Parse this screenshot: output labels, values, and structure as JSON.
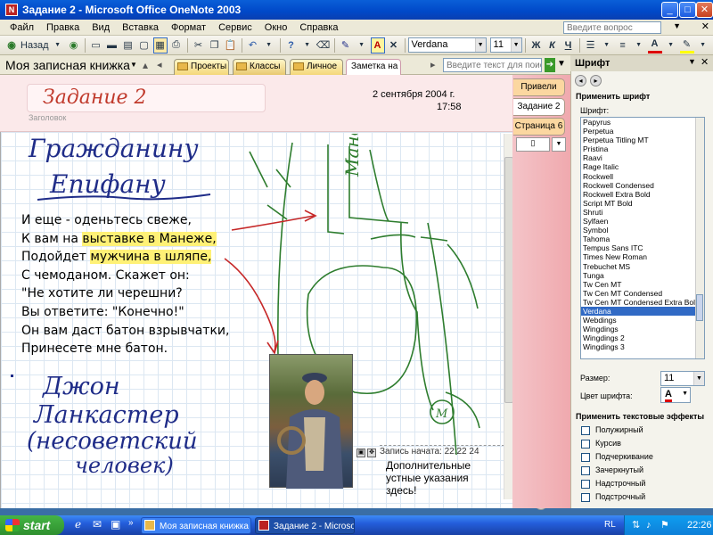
{
  "window": {
    "title": "Задание 2 - Microsoft Office OneNote 2003",
    "title_icon": "N"
  },
  "menu": [
    "Файл",
    "Правка",
    "Вид",
    "Вставка",
    "Формат",
    "Сервис",
    "Окно",
    "Справка"
  ],
  "help_placeholder": "Введите вопрос",
  "toolbar": {
    "back_label": "Назад",
    "font": "Verdana",
    "size": "11",
    "bold": "Ж",
    "italic": "К",
    "underline": "Ч"
  },
  "notebook": {
    "name": "Моя записная книжка"
  },
  "section_tabs": [
    "Проекты",
    "Классы",
    "Личное",
    "Заметка на п"
  ],
  "search_placeholder": "Введите текст для поиска",
  "page": {
    "title": "Задание 2",
    "title_label": "Заголовок",
    "date": "2 сентября 2004 г.",
    "time": "17:58",
    "hw_heading1": "Гражданину",
    "hw_heading2": "Епифану",
    "lines": [
      "И еще - оденьтесь свеже,",
      "К вам на выставке в Манеже,",
      "Подойдет мужчина в шляпе,",
      "С чемоданом. Скажет он:",
      "\"Не хотите ли черешни?",
      "Вы ответите: \"Конечно!\"",
      "Он вам даст батон взрывчатки,",
      "Принесете мне батон."
    ],
    "hl_1_pre": "К вам на ",
    "hl_1": "выставке в Манеже,",
    "hl_2_pre": "Подойдет ",
    "hl_2": "мужчина в шляпе,",
    "hw_sign": [
      "Джон",
      "Ланкастер",
      "(несоветский",
      "человек)"
    ],
    "map_label": "Манеже",
    "map_metro": "М"
  },
  "audio_note": {
    "header": "Запись начата: 22:22 24",
    "text": "Дополнительные устные указания здесь!"
  },
  "page_tabs": [
    "Привели",
    "Задание 2",
    "Страница 6"
  ],
  "task_pane": {
    "title": "Шрифт",
    "apply_font": "Применить шрифт",
    "font_label": "Шрифт:",
    "fonts": [
      "Papyrus",
      "Perpetua",
      "Perpetua Titling MT",
      "Pristina",
      "Raavi",
      "Rage Italic",
      "Rockwell",
      "Rockwell Condensed",
      "Rockwell Extra Bold",
      "Script MT Bold",
      "Shruti",
      "Sylfaen",
      "Symbol",
      "Tahoma",
      "Tempus Sans ITC",
      "Times New Roman",
      "Trebuchet MS",
      "Tunga",
      "Tw Cen MT",
      "Tw Cen MT Condensed",
      "Tw Cen MT Condensed Extra Bold",
      "Verdana",
      "Webdings",
      "Wingdings",
      "Wingdings 2",
      "Wingdings 3"
    ],
    "selected_font": "Verdana",
    "size_label": "Размер:",
    "size_value": "11",
    "color_label": "Цвет шрифта:",
    "effects_title": "Применить текстовые эффекты",
    "effects": [
      "Полужирный",
      "Курсив",
      "Подчеркивание",
      "Зачеркнутый",
      "Надстрочный",
      "Подстрочный"
    ]
  },
  "taskbar": {
    "start": "start",
    "items": [
      "Моя записная книжка",
      "Задание 2 - Microsof..."
    ],
    "lang": "RL",
    "clock": "22:26"
  }
}
